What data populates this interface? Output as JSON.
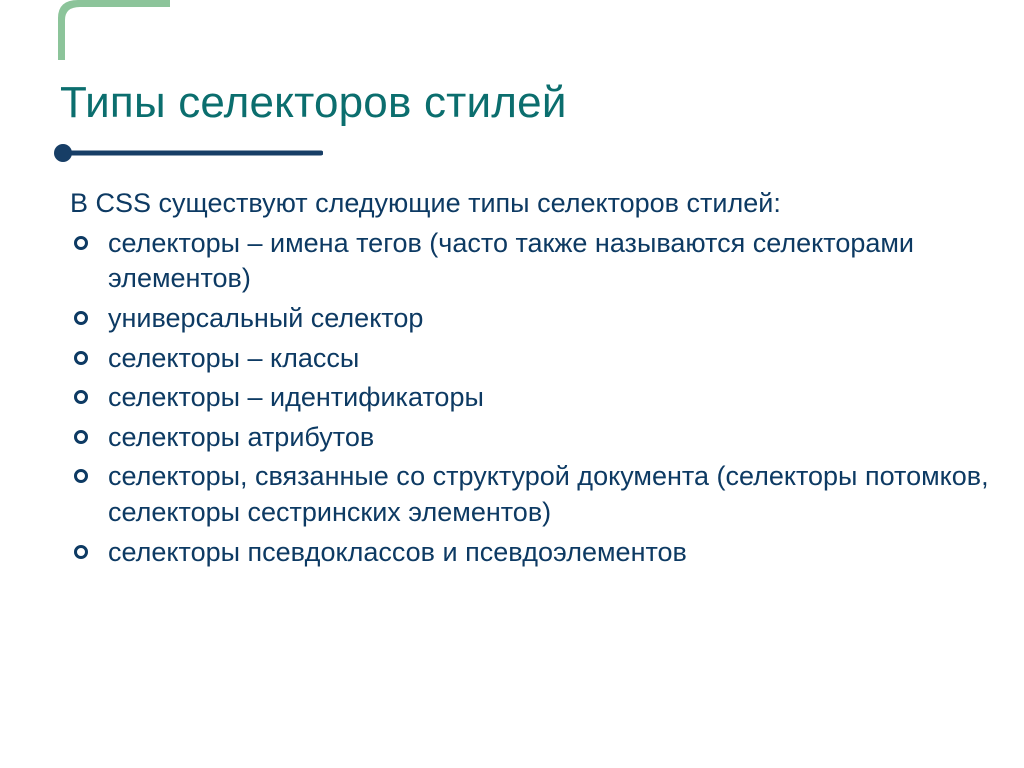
{
  "colors": {
    "title": "#0b6e6e",
    "textBody": "#0d3a63",
    "accentGreen": "#8cc49a",
    "underline": "#173e66"
  },
  "title": "Типы селекторов стилей",
  "intro": "В CSS существуют следующие типы селекторов стилей:",
  "items": [
    "селекторы – имена тегов (часто также называются селекторами элементов)",
    "универсальный селектор",
    "селекторы – классы",
    "селекторы – идентификаторы",
    "селекторы атрибутов",
    "селекторы, связанные со структурой документа (селекторы потомков, селекторы сестринских элементов)",
    "селекторы псевдоклассов и псевдоэлементов"
  ]
}
